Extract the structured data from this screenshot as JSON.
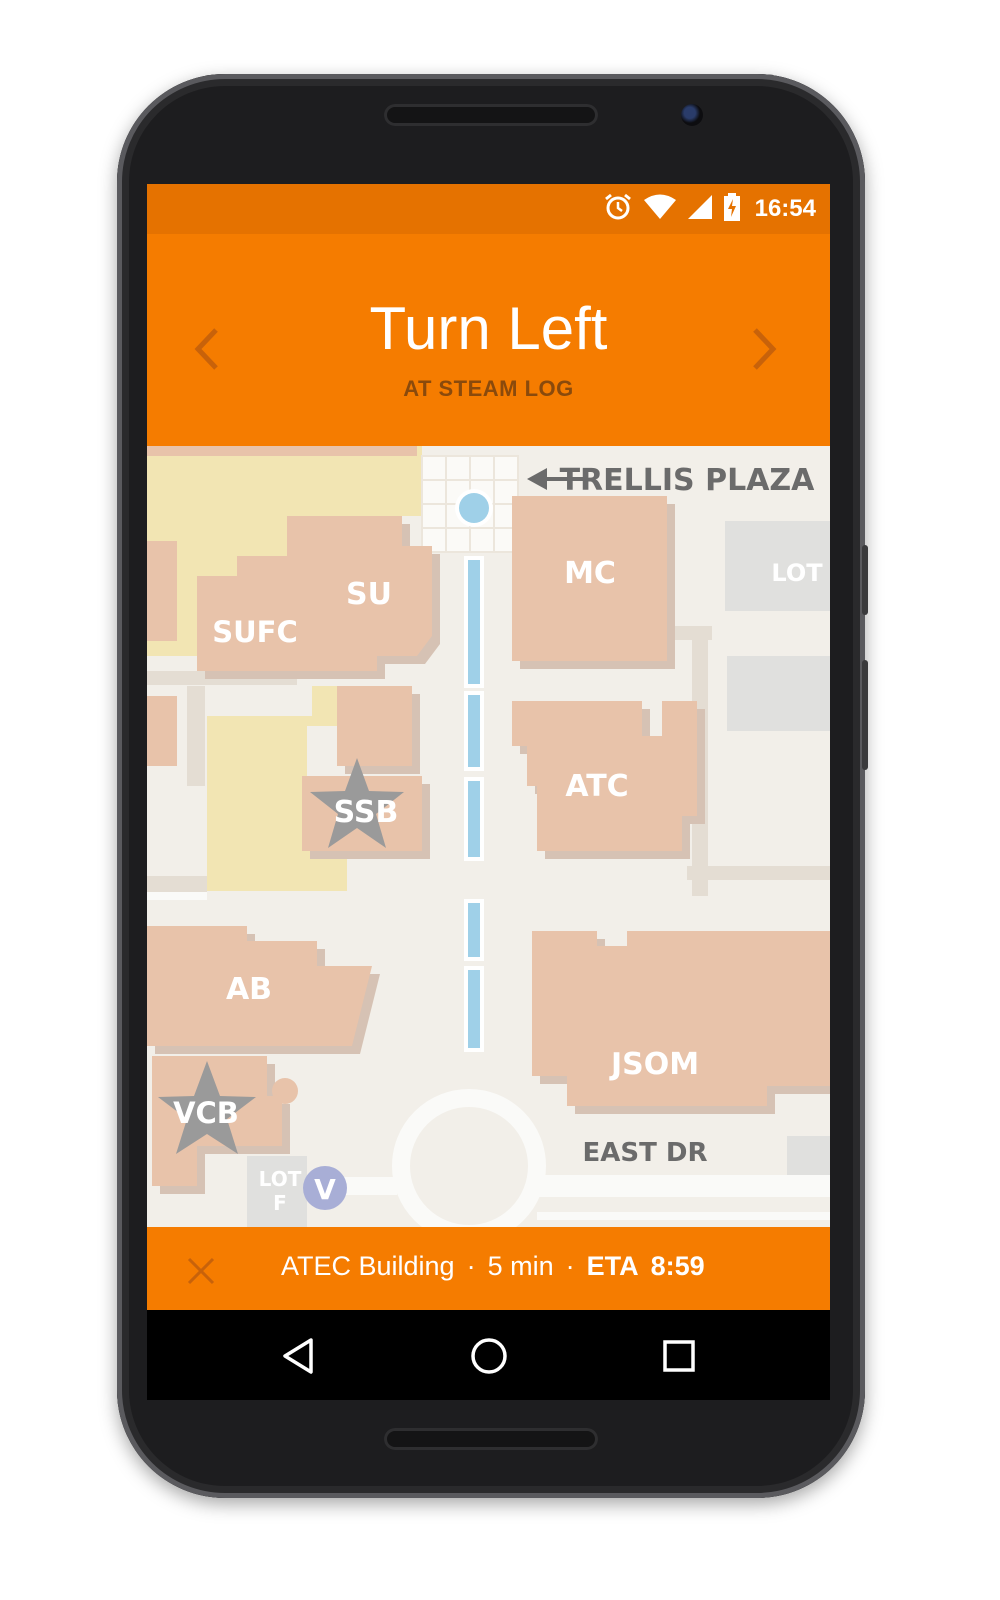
{
  "status_bar": {
    "time": "16:54",
    "icons": [
      "alarm-icon",
      "wifi-icon",
      "signal-icon",
      "battery-charging-icon"
    ]
  },
  "navigation": {
    "instruction": "Turn Left",
    "detail": "AT STEAM LOG",
    "prev_icon": "chevron-left-icon",
    "next_icon": "chevron-right-icon"
  },
  "map": {
    "labels": {
      "trellis": "TRELLIS PLAZA",
      "mc": "MC",
      "lot_top": "LOT",
      "su": "SU",
      "sufc": "SUFC",
      "atc": "ATC",
      "ssb": "SSB",
      "ab": "AB",
      "jsom": "JSOM",
      "vcb": "VCB",
      "east_dr": "EAST DR",
      "lot_f_1": "LOT",
      "lot_f_2": "F",
      "v_marker": "V"
    }
  },
  "trip": {
    "destination": "ATEC Building",
    "duration": "5 min",
    "eta_label": "ETA",
    "eta_time": "8:59",
    "separator": "·"
  },
  "system_nav": {
    "back": "back-icon",
    "home": "home-icon",
    "recents": "recents-icon"
  },
  "colors": {
    "accent": "#f57c00",
    "status_bar": "#e57200",
    "building": "#e8c3aa",
    "plaza": "#f2e5b3",
    "water": "#9fd0e8"
  }
}
